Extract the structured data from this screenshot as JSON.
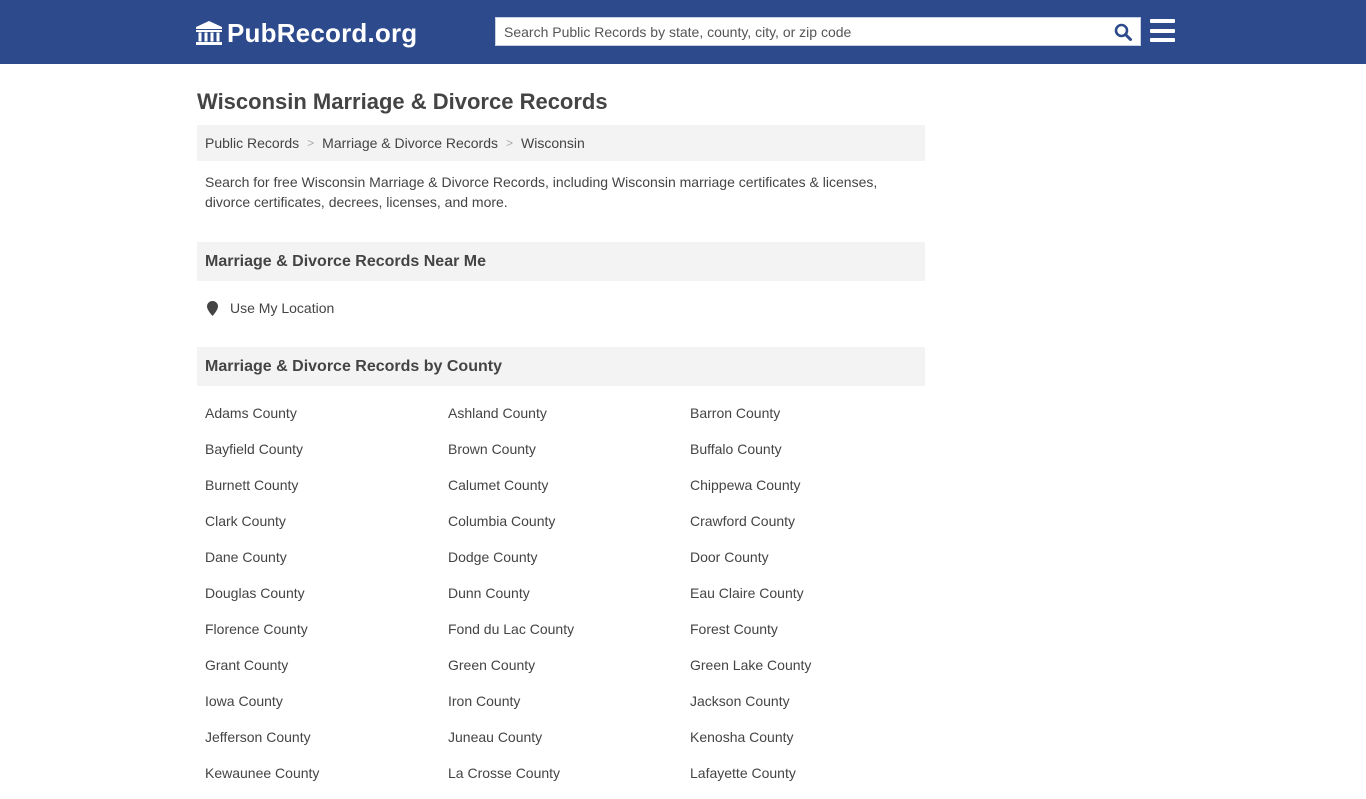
{
  "header": {
    "logo_text": "PubRecord.org",
    "logo_icon": "courthouse-icon",
    "search_placeholder": "Search Public Records by state, county, city, or zip code",
    "search_icon": "search-icon",
    "menu_icon": "hamburger-menu-icon"
  },
  "colors": {
    "header_bg": "#2d4a8c",
    "search_icon": "#2d4a8c",
    "panel_bg": "#f3f3f3",
    "text": "#444444"
  },
  "page": {
    "title": "Wisconsin Marriage & Divorce Records",
    "breadcrumb": [
      {
        "label": "Public Records"
      },
      {
        "label": "Marriage & Divorce Records"
      },
      {
        "label": "Wisconsin"
      }
    ],
    "breadcrumb_separator": ">",
    "intro": "Search for free Wisconsin Marriage & Divorce Records, including Wisconsin marriage certificates & licenses, divorce certificates, decrees, licenses, and more."
  },
  "near_me": {
    "heading": "Marriage & Divorce Records Near Me",
    "location_label": "Use My Location",
    "location_icon": "map-marker-icon"
  },
  "by_county": {
    "heading": "Marriage & Divorce Records by County",
    "counties": [
      "Adams County",
      "Ashland County",
      "Barron County",
      "Bayfield County",
      "Brown County",
      "Buffalo County",
      "Burnett County",
      "Calumet County",
      "Chippewa County",
      "Clark County",
      "Columbia County",
      "Crawford County",
      "Dane County",
      "Dodge County",
      "Door County",
      "Douglas County",
      "Dunn County",
      "Eau Claire County",
      "Florence County",
      "Fond du Lac County",
      "Forest County",
      "Grant County",
      "Green County",
      "Green Lake County",
      "Iowa County",
      "Iron County",
      "Jackson County",
      "Jefferson County",
      "Juneau County",
      "Kenosha County",
      "Kewaunee County",
      "La Crosse County",
      "Lafayette County"
    ]
  }
}
